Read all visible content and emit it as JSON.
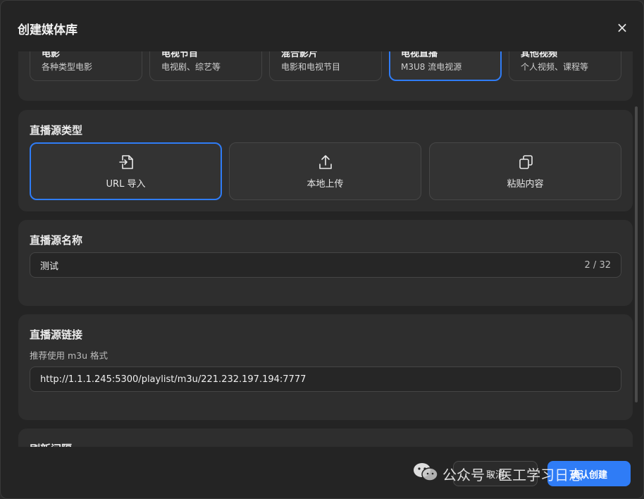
{
  "dialog": {
    "title": "创建媒体库",
    "close_glyph": "×"
  },
  "library_types": [
    {
      "name": "电影",
      "desc": "各种类型电影",
      "selected": false
    },
    {
      "name": "电视节目",
      "desc": "电视剧、综艺等",
      "selected": false
    },
    {
      "name": "混合影片",
      "desc": "电影和电视节目",
      "selected": false
    },
    {
      "name": "电视直播",
      "desc": "M3U8 流电视源",
      "selected": true
    },
    {
      "name": "其他视频",
      "desc": "个人视频、课程等",
      "selected": false
    }
  ],
  "source_type": {
    "title": "直播源类型",
    "options": [
      {
        "label": "URL 导入",
        "icon": "file-import-icon",
        "selected": true
      },
      {
        "label": "本地上传",
        "icon": "upload-icon",
        "selected": false
      },
      {
        "label": "粘贴内容",
        "icon": "copy-icon",
        "selected": false
      }
    ]
  },
  "source_name": {
    "title": "直播源名称",
    "value": "测试",
    "counter": "2 / 32"
  },
  "source_link": {
    "title": "直播源链接",
    "hint": "推荐使用 m3u 格式",
    "value": "http://1.1.1.245:5300/playlist/m3u/221.232.197.194:7777"
  },
  "refresh_interval": {
    "title": "刷新间隔"
  },
  "footer": {
    "cancel_label": "取消",
    "confirm_label": "确认创建"
  },
  "watermark": {
    "text": "公众号 · 医工学习日志"
  },
  "colors": {
    "accent": "#2f7cf6",
    "background": "#242424",
    "card": "#2e2e2e"
  }
}
